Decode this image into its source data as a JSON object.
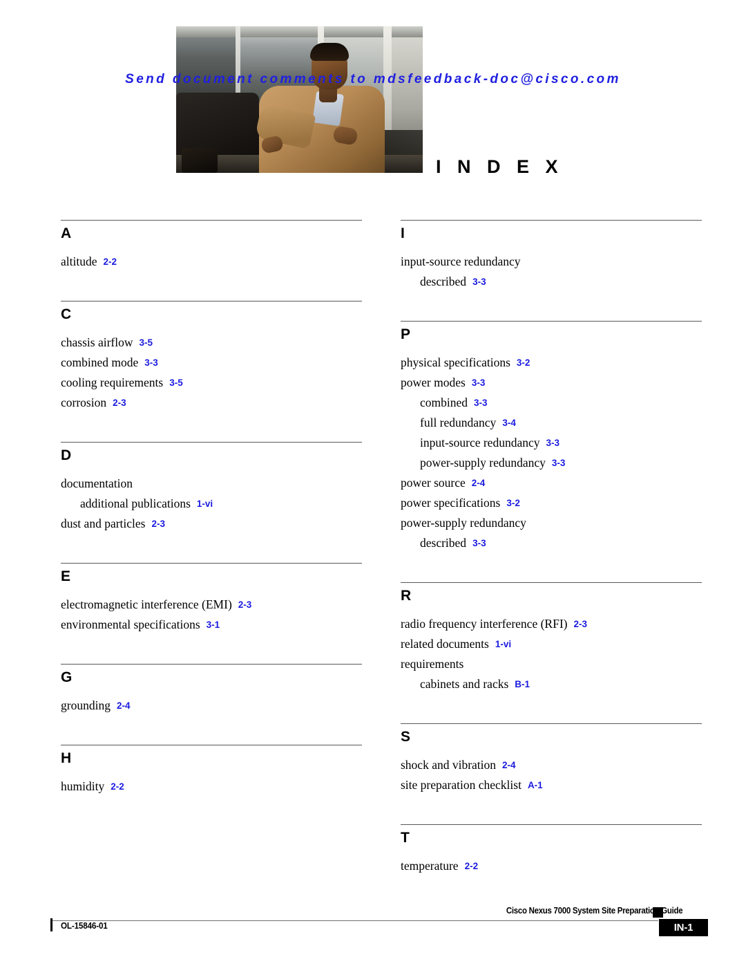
{
  "header": {
    "comment_line": "Send document comments to mdsfeedback-doc@cisco.com",
    "index_title": "I N D E X",
    "photo_alt": "office-lounge-photo"
  },
  "colors": {
    "page_reference": "#1a1ae0",
    "comment_text": "#2020e0",
    "rule": "#58585a",
    "footer_box": "#000000"
  },
  "columns": {
    "left": [
      {
        "letter": "A",
        "entries": [
          {
            "term": "altitude",
            "ref": "2-2",
            "level": 0
          }
        ]
      },
      {
        "letter": "C",
        "entries": [
          {
            "term": "chassis airflow",
            "ref": "3-5",
            "level": 0
          },
          {
            "term": "combined mode",
            "ref": "3-3",
            "level": 0
          },
          {
            "term": "cooling requirements",
            "ref": "3-5",
            "level": 0
          },
          {
            "term": "corrosion",
            "ref": "2-3",
            "level": 0
          }
        ]
      },
      {
        "letter": "D",
        "entries": [
          {
            "term": "documentation",
            "ref": "",
            "level": 0
          },
          {
            "term": "additional publications",
            "ref": "1-vi",
            "level": 1
          },
          {
            "term": "dust and particles",
            "ref": "2-3",
            "level": 0
          }
        ]
      },
      {
        "letter": "E",
        "entries": [
          {
            "term": "electromagnetic interference (EMI)",
            "ref": "2-3",
            "level": 0
          },
          {
            "term": "environmental specifications",
            "ref": "3-1",
            "level": 0
          }
        ]
      },
      {
        "letter": "G",
        "entries": [
          {
            "term": "grounding",
            "ref": "2-4",
            "level": 0
          }
        ]
      },
      {
        "letter": "H",
        "entries": [
          {
            "term": "humidity",
            "ref": "2-2",
            "level": 0
          }
        ]
      }
    ],
    "right": [
      {
        "letter": "I",
        "entries": [
          {
            "term": "input-source redundancy",
            "ref": "",
            "level": 0
          },
          {
            "term": "described",
            "ref": "3-3",
            "level": 1
          }
        ]
      },
      {
        "letter": "P",
        "entries": [
          {
            "term": "physical specifications",
            "ref": "3-2",
            "level": 0
          },
          {
            "term": "power modes",
            "ref": "3-3",
            "level": 0
          },
          {
            "term": "combined",
            "ref": "3-3",
            "level": 1
          },
          {
            "term": "full redundancy",
            "ref": "3-4",
            "level": 1
          },
          {
            "term": "input-source redundancy",
            "ref": "3-3",
            "level": 1
          },
          {
            "term": "power-supply redundancy",
            "ref": "3-3",
            "level": 1
          },
          {
            "term": "power source",
            "ref": "2-4",
            "level": 0
          },
          {
            "term": "power specifications",
            "ref": "3-2",
            "level": 0
          },
          {
            "term": "power-supply redundancy",
            "ref": "",
            "level": 0
          },
          {
            "term": "described",
            "ref": "3-3",
            "level": 1
          }
        ]
      },
      {
        "letter": "R",
        "entries": [
          {
            "term": "radio frequency interference (RFI)",
            "ref": "2-3",
            "level": 0
          },
          {
            "term": "related documents",
            "ref": "1-vi",
            "level": 0
          },
          {
            "term": "requirements",
            "ref": "",
            "level": 0
          },
          {
            "term": "cabinets and racks",
            "ref": "B-1",
            "level": 1
          }
        ]
      },
      {
        "letter": "S",
        "entries": [
          {
            "term": "shock and vibration",
            "ref": "2-4",
            "level": 0
          },
          {
            "term": "site preparation checklist",
            "ref": "A-1",
            "level": 0
          }
        ]
      },
      {
        "letter": "T",
        "entries": [
          {
            "term": "temperature",
            "ref": "2-2",
            "level": 0
          }
        ]
      }
    ]
  },
  "footer": {
    "guide_title": "Cisco Nexus 7000 System Site Preparation Guide",
    "document_id": "OL-15846-01",
    "page_number": "IN-1"
  }
}
